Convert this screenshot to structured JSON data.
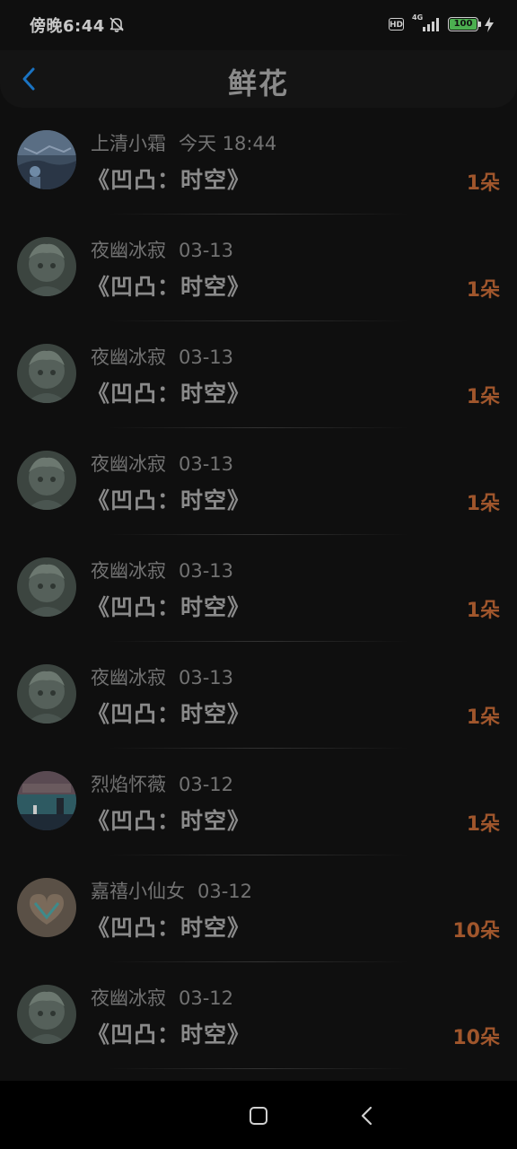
{
  "status_bar": {
    "time": "傍晚6:44",
    "hd_label": "HD",
    "network_label": "4G",
    "battery_level": "100",
    "icons": [
      "bell-off-icon",
      "signal-icon",
      "battery-icon",
      "charging-bolt-icon"
    ]
  },
  "header": {
    "title": "鲜花",
    "back_icon": "chevron-left-icon"
  },
  "colors": {
    "background": "#0f0f0f",
    "accent": "#1a73c2",
    "count": "#a0562c",
    "battery": "#4caf50"
  },
  "items": [
    {
      "name": "上清小霜",
      "date": "今天 18:44",
      "book": "《凹凸：时空》",
      "count": "1朵",
      "avatar": "landscape"
    },
    {
      "name": "夜幽冰寂",
      "date": "03-13",
      "book": "《凹凸：时空》",
      "count": "1朵",
      "avatar": "character"
    },
    {
      "name": "夜幽冰寂",
      "date": "03-13",
      "book": "《凹凸：时空》",
      "count": "1朵",
      "avatar": "character"
    },
    {
      "name": "夜幽冰寂",
      "date": "03-13",
      "book": "《凹凸：时空》",
      "count": "1朵",
      "avatar": "character"
    },
    {
      "name": "夜幽冰寂",
      "date": "03-13",
      "book": "《凹凸：时空》",
      "count": "1朵",
      "avatar": "character"
    },
    {
      "name": "夜幽冰寂",
      "date": "03-13",
      "book": "《凹凸：时空》",
      "count": "1朵",
      "avatar": "character"
    },
    {
      "name": "烈焰怀薇",
      "date": "03-12",
      "book": "《凹凸：时空》",
      "count": "1朵",
      "avatar": "sea"
    },
    {
      "name": "嘉禧小仙女",
      "date": "03-12",
      "book": "《凹凸：时空》",
      "count": "10朵",
      "avatar": "heart"
    },
    {
      "name": "夜幽冰寂",
      "date": "03-12",
      "book": "《凹凸：时空》",
      "count": "10朵",
      "avatar": "character"
    }
  ],
  "nav_bar": {
    "icons": [
      "home-square-icon",
      "back-triangle-icon"
    ]
  }
}
